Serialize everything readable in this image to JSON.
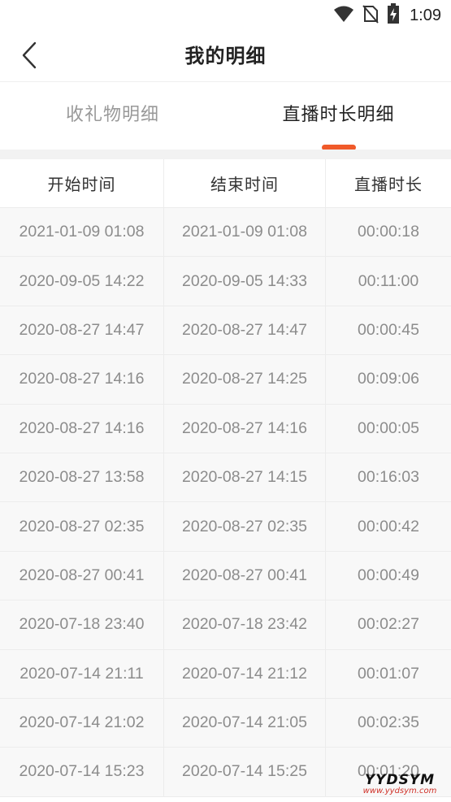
{
  "status_bar": {
    "time": "1:09",
    "icons": [
      "wifi-icon",
      "no-sim-icon",
      "battery-charging-icon"
    ]
  },
  "header": {
    "title": "我的明细",
    "back_icon": "chevron-left-icon"
  },
  "tabs": [
    {
      "label": "收礼物明细",
      "active": false
    },
    {
      "label": "直播时长明细",
      "active": true
    }
  ],
  "colors": {
    "accent": "#f05a2a",
    "row_background": "#f8f8f8",
    "muted_text": "#8c8c8c"
  },
  "table": {
    "headers": [
      "开始时间",
      "结束时间",
      "直播时长"
    ],
    "rows": [
      [
        "2021-01-09 01:08",
        "2021-01-09 01:08",
        "00:00:18"
      ],
      [
        "2020-09-05 14:22",
        "2020-09-05 14:33",
        "00:11:00"
      ],
      [
        "2020-08-27 14:47",
        "2020-08-27 14:47",
        "00:00:45"
      ],
      [
        "2020-08-27 14:16",
        "2020-08-27 14:25",
        "00:09:06"
      ],
      [
        "2020-08-27 14:16",
        "2020-08-27 14:16",
        "00:00:05"
      ],
      [
        "2020-08-27 13:58",
        "2020-08-27 14:15",
        "00:16:03"
      ],
      [
        "2020-08-27 02:35",
        "2020-08-27 02:35",
        "00:00:42"
      ],
      [
        "2020-08-27 00:41",
        "2020-08-27 00:41",
        "00:00:49"
      ],
      [
        "2020-07-18 23:40",
        "2020-07-18 23:42",
        "00:02:27"
      ],
      [
        "2020-07-14 21:11",
        "2020-07-14 21:12",
        "00:01:07"
      ],
      [
        "2020-07-14 21:02",
        "2020-07-14 21:05",
        "00:02:35"
      ],
      [
        "2020-07-14 15:23",
        "2020-07-14 15:25",
        "00:01:20"
      ]
    ]
  },
  "watermark": {
    "logo": "YYDSYM",
    "url": "www.yydsym.com"
  }
}
